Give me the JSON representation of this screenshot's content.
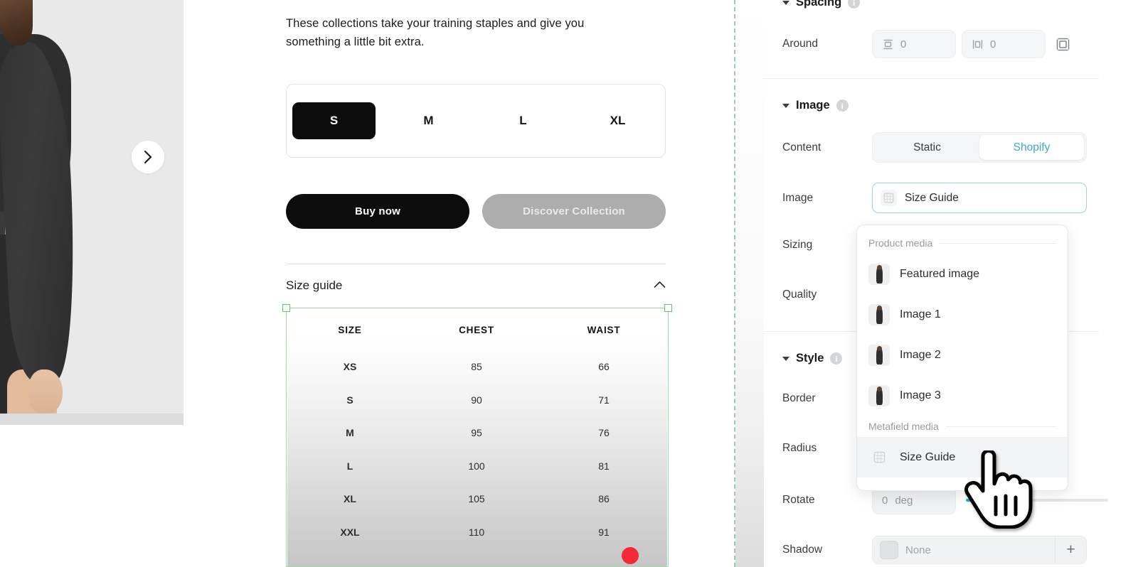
{
  "gallery": {
    "next_icon": "chevron-right-icon"
  },
  "product": {
    "description": "These collections take your training staples and give you something a little bit extra.",
    "sizes": [
      {
        "label": "S",
        "selected": true
      },
      {
        "label": "M",
        "selected": false
      },
      {
        "label": "L",
        "selected": false
      },
      {
        "label": "XL",
        "selected": false
      }
    ],
    "buy_now_label": "Buy now",
    "discover_label": "Discover Collection",
    "size_guide_title": "Size guide",
    "size_guide_collapse_icon": "chevron-up-icon"
  },
  "size_table": {
    "headers": [
      "SIZE",
      "CHEST",
      "WAIST"
    ],
    "rows": [
      [
        "XS",
        "85",
        "66"
      ],
      [
        "S",
        "90",
        "71"
      ],
      [
        "M",
        "95",
        "76"
      ],
      [
        "L",
        "100",
        "81"
      ],
      [
        "XL",
        "105",
        "86"
      ],
      [
        "XXL",
        "110",
        "91"
      ]
    ]
  },
  "inspector": {
    "spacing": {
      "title": "Spacing",
      "around_label": "Around",
      "vertical_value": "0",
      "horizontal_value": "0",
      "vertical_icon": "spacing-vertical-icon",
      "horizontal_icon": "spacing-horizontal-icon",
      "all_sides_icon": "spacing-all-icon"
    },
    "image": {
      "title": "Image",
      "content_label": "Content",
      "content_options": [
        "Static",
        "Shopify"
      ],
      "content_selected": "Shopify",
      "image_label": "Image",
      "image_value": "Size Guide",
      "image_value_icon": "table-grid-icon",
      "sizing_label": "Sizing",
      "quality_label": "Quality"
    },
    "dropdown": {
      "group_product": "Product media",
      "group_metafield": "Metafield media",
      "product_items": [
        {
          "label": "Featured image",
          "icon": "model-thumbnail"
        },
        {
          "label": "Image 1",
          "icon": "model-thumbnail"
        },
        {
          "label": "Image 2",
          "icon": "model-thumbnail"
        },
        {
          "label": "Image 3",
          "icon": "model-thumbnail"
        }
      ],
      "metafield_items": [
        {
          "label": "Size Guide",
          "icon": "table-grid-icon",
          "hovered": true
        }
      ]
    },
    "style": {
      "title": "Style",
      "border_label": "Border",
      "radius_label": "Radius",
      "rotate_label": "Rotate",
      "rotate_value": "0",
      "rotate_unit": "deg",
      "shadow_label": "Shadow",
      "shadow_value": "None",
      "shadow_add_icon": "plus-icon"
    },
    "accent_color": "#3fa8c4",
    "focus_border_color": "#9bd2e4",
    "selection_color": "#8fd39b"
  },
  "cursor": {
    "icon": "pointing-hand-cursor"
  }
}
